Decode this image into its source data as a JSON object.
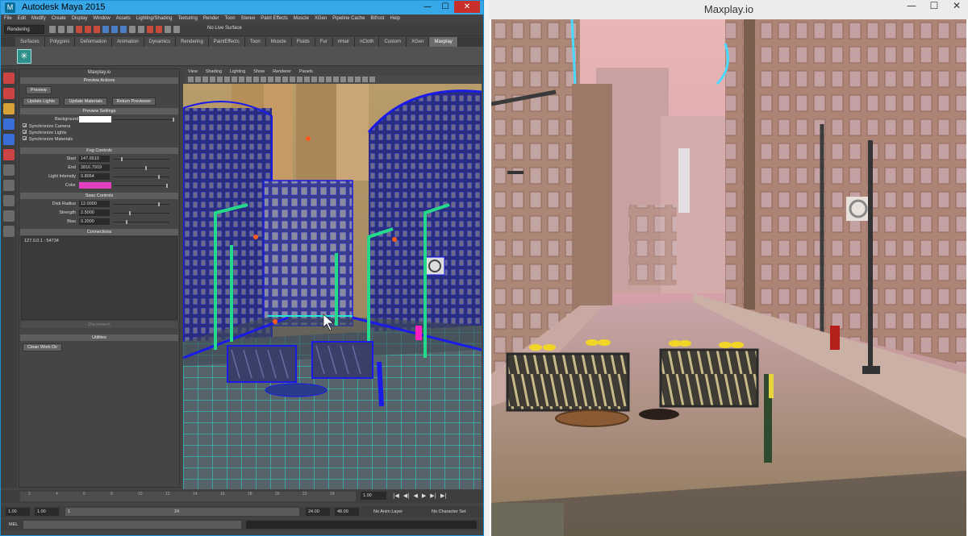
{
  "maya": {
    "title": "Autodesk Maya 2015",
    "window_buttons": [
      "—",
      "☐",
      "✕"
    ],
    "menus": [
      "File",
      "Edit",
      "Modify",
      "Create",
      "Display",
      "Window",
      "Assets",
      "Lighting/Shading",
      "Texturing",
      "Render",
      "Toon",
      "Stereo",
      "Paint Effects",
      "Muscle",
      "XGen",
      "Pipeline Cache",
      "Bifrost",
      "Help"
    ],
    "mode": "Rendering",
    "live_surface": "No Live Surface",
    "shelf_tabs": [
      "Surfaces",
      "Polygons",
      "Deformation",
      "Animation",
      "Dynamics",
      "Rendering",
      "PaintEffects",
      "Toon",
      "Muscle",
      "Fluids",
      "Fur",
      "nHair",
      "nCloth",
      "Custom",
      "XGen",
      "Maxplay"
    ],
    "active_shelf_tab": "Maxplay",
    "viewport_menus": [
      "View",
      "Shading",
      "Lighting",
      "Show",
      "Renderer",
      "Panels"
    ],
    "panel": {
      "title": "Maxplay.io",
      "preview_actions": {
        "header": "Preview Actions",
        "preview_btn": "Preview",
        "update_lights": "Update Lights",
        "update_materials": "Update Materials",
        "return_previewer": "Return Previewer"
      },
      "preview_settings": {
        "header": "Preview Settings",
        "background_color_label": "Background Color",
        "sync_camera": "Synchronize Camera",
        "sync_lights": "Synchronize Lights",
        "sync_materials": "Synchronize Materials"
      },
      "fog_controls": {
        "header": "Fog Controls",
        "start_label": "Start",
        "start_value": "147.6510",
        "end_label": "End",
        "end_value": "2816.7919",
        "intensity_label": "Light Intensity",
        "intensity_value": "0.8054",
        "color_label": "Color",
        "color_hex": "#e23fc3"
      },
      "ssao_controls": {
        "header": "Ssao Controls",
        "disk_radius_label": "Disk Radius",
        "disk_radius_value": "12.0000",
        "strength_label": "Strength",
        "strength_value": "2.5000",
        "bias_label": "Bias",
        "bias_value": "0.2000"
      },
      "connections": {
        "header": "Connections",
        "entry": "127.0.0.1 : 54734",
        "disconnect": "Disconnect"
      },
      "utilities": {
        "header": "Utilities",
        "clean_work_dir": "Clean Work Dir"
      }
    },
    "timeline": {
      "ticks": [
        "2",
        "4",
        "6",
        "8",
        "10",
        "12",
        "14",
        "16",
        "18",
        "20",
        "22",
        "24"
      ],
      "current_frame": "1.00",
      "playback_buttons": [
        "|◀",
        "◀|",
        "◀",
        "▶",
        "▶|",
        "▶|"
      ]
    },
    "range": {
      "start": "1.00",
      "start2": "1.00",
      "inner_start": "1",
      "inner_end": "24",
      "end": "24.00",
      "end2": "48.00",
      "anim_layer": "No Anim Layer",
      "character_set": "No Character Set"
    },
    "mel_label": "MEL"
  },
  "maxplay": {
    "title": "Maxplay.io",
    "window_buttons": [
      "—",
      "☐",
      "✕"
    ]
  }
}
